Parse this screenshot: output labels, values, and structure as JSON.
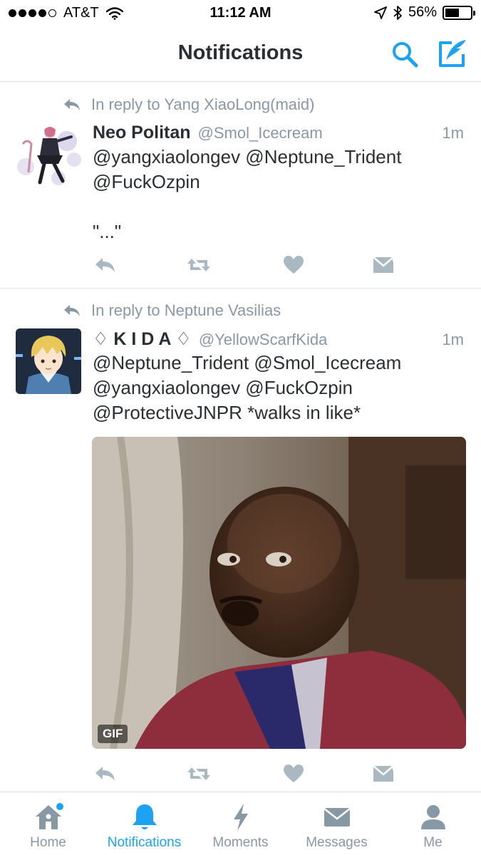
{
  "status_bar": {
    "carrier": "AT&T",
    "time": "11:12 AM",
    "battery": "56%",
    "battery_level": 0.56,
    "signal_bars": 4,
    "signal_total": 5
  },
  "nav": {
    "title": "Notifications",
    "search_icon": "search-icon",
    "compose_icon": "compose-tweet-icon"
  },
  "tweets": [
    {
      "reply_to": "In reply to Yang XiaoLong(maid)",
      "name": "Neo Politan",
      "handle": "@Smol_Icecream",
      "time": "1m",
      "text": "@yangxiaolongev @Neptune_Trident\n@FuckOzpin\n\n\"...\""
    },
    {
      "reply_to": "In reply to Neptune Vasilias",
      "name": "♢ K I D A ♢",
      "handle": "@YellowScarfKida",
      "time": "1m",
      "text": "@Neptune_Trident @Smol_Icecream\n@yangxiaolongev @FuckOzpin\n@ProtectiveJNPR *walks in like*",
      "media_badge": "GIF"
    }
  ],
  "tabs": [
    {
      "label": "Home",
      "icon": "home-icon",
      "has_dot": true
    },
    {
      "label": "Notifications",
      "icon": "bell-icon",
      "active": true
    },
    {
      "label": "Moments",
      "icon": "lightning-icon"
    },
    {
      "label": "Messages",
      "icon": "envelope-icon"
    },
    {
      "label": "Me",
      "icon": "person-icon"
    }
  ],
  "colors": {
    "accent": "#1da1f2",
    "muted": "#8899a6",
    "text": "#292f33",
    "divider": "#e1e8ed"
  }
}
